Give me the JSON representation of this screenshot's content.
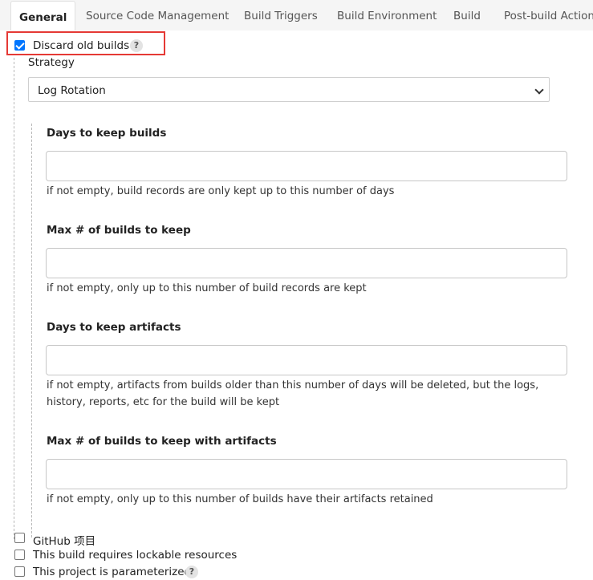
{
  "tabs": [
    {
      "label": "General",
      "active": true
    },
    {
      "label": "Source Code Management"
    },
    {
      "label": "Build Triggers"
    },
    {
      "label": "Build Environment"
    },
    {
      "label": "Build"
    },
    {
      "label": "Post-build Actions"
    }
  ],
  "discard": {
    "label": "Discard old builds",
    "checked": true,
    "help": "?"
  },
  "strategy": {
    "label": "Strategy",
    "selected": "Log Rotation"
  },
  "fields": [
    {
      "label": "Days to keep builds",
      "value": "",
      "hint": "if not empty, build records are only kept up to this number of days"
    },
    {
      "label": "Max # of builds to keep",
      "value": "",
      "hint": "if not empty, only up to this number of build records are kept"
    },
    {
      "label": "Days to keep artifacts",
      "value": "",
      "hint": "if not empty, artifacts from builds older than this number of days will be deleted, but the logs, history, reports, etc for the build will be kept"
    },
    {
      "label": "Max # of builds to keep with artifacts",
      "value": "",
      "hint": "if not empty, only up to this number of builds have their artifacts retained"
    }
  ],
  "options": [
    {
      "label": "GitHub 项目",
      "checked": false
    },
    {
      "label": "This build requires lockable resources",
      "checked": false
    },
    {
      "label": "This project is parameterized",
      "checked": false,
      "help": "?"
    }
  ],
  "colors": {
    "accent": "#0075ff",
    "highlight": "#e53935"
  }
}
